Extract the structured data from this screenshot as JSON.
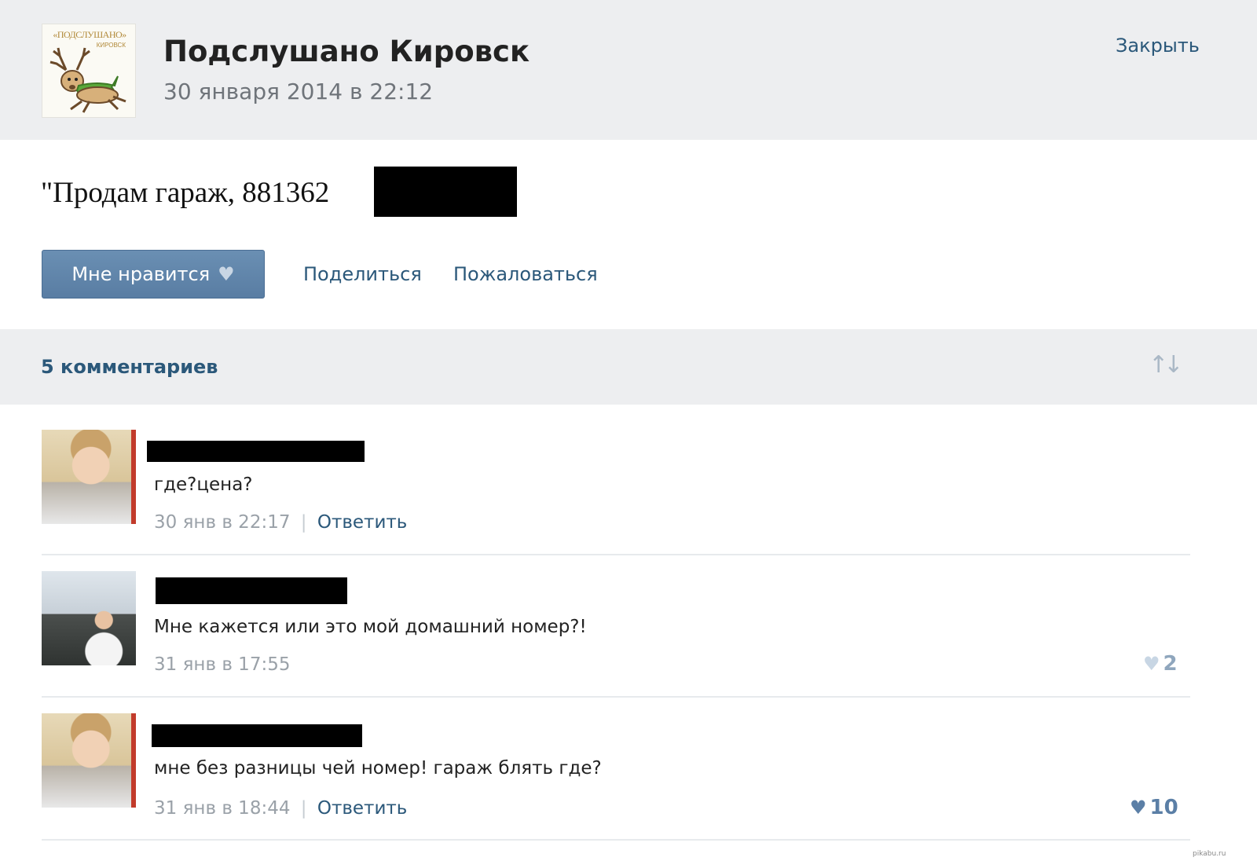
{
  "header": {
    "group_name": "Подслушано Кировск",
    "date": "30 января 2014 в 22:12",
    "close_label": "Закрыть",
    "avatar_logo_text": "«ПОДСЛУШАНО»",
    "avatar_logo_sub": "КИРОВСК"
  },
  "post": {
    "text": "\"Продам гараж, 881362"
  },
  "actions": {
    "like_label": "Мне нравится",
    "share_label": "Поделиться",
    "report_label": "Пожаловаться"
  },
  "comments_header": {
    "count_label": "5 комментариев",
    "sort_icon": "sort-arrows-icon"
  },
  "comments": [
    {
      "text": "где?цена?",
      "time": "30 янв в 22:17",
      "reply": "Ответить",
      "likes": null
    },
    {
      "text": "Мне кажется или это мой домашний номер?!",
      "time": "31 янв в 17:55",
      "reply": null,
      "likes": "2"
    },
    {
      "text": "мне без разницы чей номер! гараж блять где?",
      "time": "31 янв в 18:44",
      "reply": "Ответить",
      "likes": "10"
    }
  ],
  "separator": "|",
  "watermark": "pikabu.ru",
  "colors": {
    "link": "#2b587a",
    "header_bg": "#edeef0",
    "button": "#5e83a9"
  }
}
